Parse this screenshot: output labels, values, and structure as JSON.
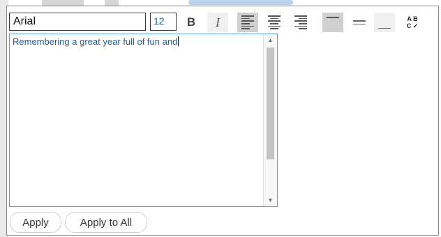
{
  "toolbar": {
    "font_name": "Arial",
    "font_size": "12",
    "bold_glyph": "B",
    "italic_glyph": "I",
    "spellcheck": {
      "top": "A B",
      "bottom": "C ✓"
    }
  },
  "editor": {
    "text": "Remembering a great year full of fun and",
    "scroll_up": "▲",
    "scroll_down": "▼"
  },
  "buttons": {
    "apply": "Apply",
    "apply_all": "Apply to All"
  },
  "colors": {
    "text_blue": "#1f5f9c",
    "focus_border": "#5aa0d8",
    "active_button": "#d0d0d0"
  }
}
